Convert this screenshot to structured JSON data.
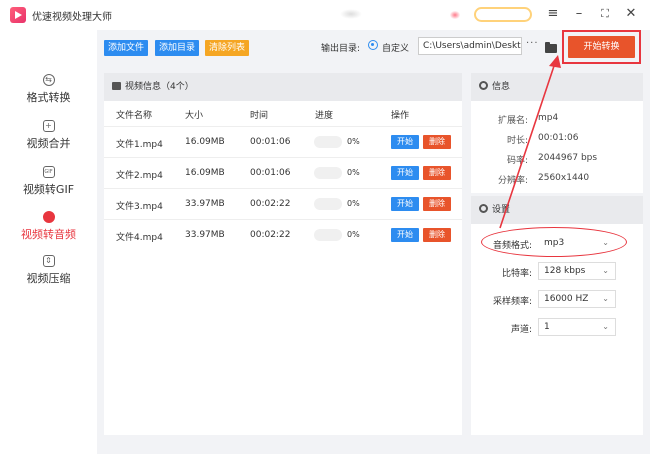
{
  "window": {
    "title": "优速视频处理大师",
    "controls": [
      "menu-icon",
      "minimize-icon",
      "maximize-icon",
      "close-icon"
    ]
  },
  "sidebar": {
    "items": [
      {
        "label": "格式转换",
        "icon": "format-convert-icon"
      },
      {
        "label": "视频合并",
        "icon": "merge-icon"
      },
      {
        "label": "视频转GIF",
        "icon": "gif-icon"
      },
      {
        "label": "视频转音频",
        "icon": "audio-icon",
        "active": true
      },
      {
        "label": "视频压缩",
        "icon": "compress-icon"
      }
    ]
  },
  "toolbar": {
    "add_file": "添加文件",
    "add_folder": "添加目录",
    "clear_list": "清除列表",
    "output_label": "输出目录:",
    "custom_label": "自定义",
    "output_path": "C:\\Users\\admin\\Deskto",
    "more": "···",
    "start": "开始转换"
  },
  "video_panel": {
    "title": "视频信息（4个）",
    "columns": [
      "文件名称",
      "大小",
      "时间",
      "进度",
      "操作"
    ],
    "rows": [
      {
        "name": "文件1.mp4",
        "size": "16.09MB",
        "time": "00:01:06",
        "progress": "0%"
      },
      {
        "name": "文件2.mp4",
        "size": "16.09MB",
        "time": "00:01:06",
        "progress": "0%"
      },
      {
        "name": "文件3.mp4",
        "size": "33.97MB",
        "time": "00:02:22",
        "progress": "0%"
      },
      {
        "name": "文件4.mp4",
        "size": "33.97MB",
        "time": "00:02:22",
        "progress": "0%"
      }
    ],
    "start_btn": "开始",
    "delete_btn": "删除"
  },
  "info_panel": {
    "title": "信息",
    "fields": [
      {
        "label": "扩展名:",
        "value": "mp4"
      },
      {
        "label": "时长:",
        "value": "00:01:06"
      },
      {
        "label": "码率:",
        "value": "2044967 bps"
      },
      {
        "label": "分辨率:",
        "value": "2560x1440"
      }
    ]
  },
  "settings_panel": {
    "title": "设置",
    "fields": [
      {
        "label": "音频格式:",
        "value": "mp3"
      },
      {
        "label": "比特率:",
        "value": "128 kbps"
      },
      {
        "label": "采样频率:",
        "value": "16000 HZ"
      },
      {
        "label": "声道:",
        "value": "1"
      }
    ]
  },
  "colors": {
    "accent_blue": "#2d8cf0",
    "accent_red": "#e8363f",
    "accent_orange": "#f5a623",
    "start_button": "#e8542b"
  }
}
